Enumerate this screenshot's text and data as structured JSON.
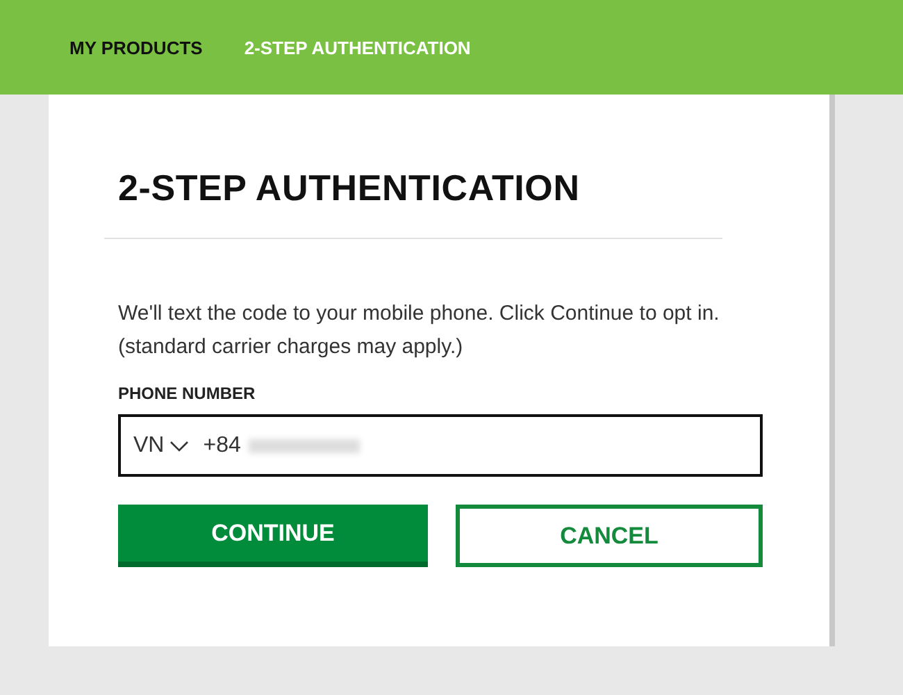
{
  "tabs": [
    {
      "label": "MY PRODUCTS",
      "selected": false
    },
    {
      "label": "2-STEP AUTHENTICATION",
      "selected": true
    }
  ],
  "card": {
    "title": "2-STEP AUTHENTICATION",
    "message": "We'll text the code to your mobile phone. Click Continue to opt in. (standard carrier charges may apply.)",
    "phone": {
      "label": "PHONE NUMBER",
      "country": "VN",
      "prefix": "+84"
    },
    "buttons": [
      {
        "label": "CONTINUE",
        "kind": "primary"
      },
      {
        "label": "CANCEL",
        "kind": "secondary"
      }
    ]
  }
}
